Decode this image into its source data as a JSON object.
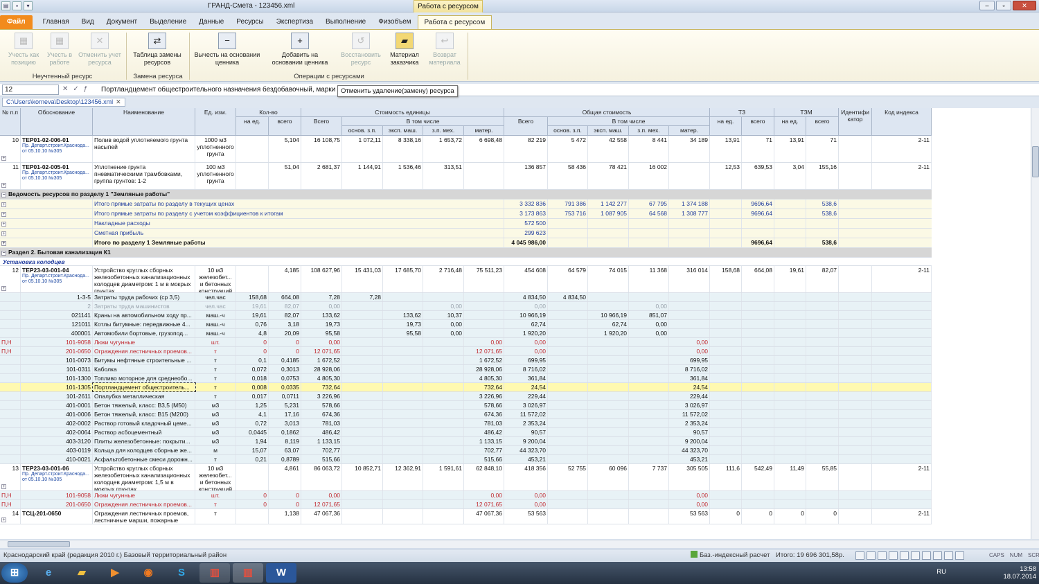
{
  "title": {
    "doc": "ГРАНД-Смета - 123456.xml",
    "context_tab": "Работа с ресурсом"
  },
  "menu": {
    "file": "Файл",
    "tabs": [
      "Главная",
      "Вид",
      "Документ",
      "Выделение",
      "Данные",
      "Ресурсы",
      "Экспертиза",
      "Выполнение",
      "Физобъем"
    ],
    "active": "Работа с ресурсом"
  },
  "ribbon": {
    "b1": "Учесть как позицию",
    "b2": "Учесть в работе",
    "b3": "Отменить учет ресурса",
    "g1": "Неучтенный ресурс",
    "b4": "Таблица замены ресурсов",
    "g2": "Замена ресурса",
    "b5": "Вычесть на основании ценника",
    "b6": "Добавить на основании ценника",
    "b7": "Восстановить ресурс",
    "b8": "Материал заказчика",
    "b9": "Возврат материала",
    "g3": "Операции с ресурсами"
  },
  "formula": {
    "cell": "12",
    "value": "Портландцемент общестроительного назначения бездобавочный, марки",
    "tooltip": "Отменить удаление(замену) ресурса"
  },
  "doc_path": "C:\\Users\\korneva\\Desktop\\123456.xml",
  "headers": {
    "n": "№ п.п",
    "osn": "Обоснование",
    "name": "Наименование",
    "ed": "Ед. изм.",
    "kolvo": "Кол-во",
    "na_ed": "на ед.",
    "vsego": "всего",
    "stoim": "Стоимость единицы",
    "v_tom": "В том числе",
    "vsego2": "Всего",
    "osn_zp": "основ. з.п.",
    "eksp": "эксп. маш.",
    "zpmeh": "з.п. мех.",
    "mater": "матер.",
    "obsh": "Общая стоимость",
    "tz": "ТЗ",
    "tzm": "ТЗМ",
    "ident": "Идентифи катор",
    "kod": "Код индекса"
  },
  "sub": {
    "a": "Пр. Департ.строит.Краснода...",
    "b": "от 05.10.10 №305"
  },
  "rows": [
    {
      "t": "pos",
      "n": "10",
      "osn": "ТЕР01-02-006-01",
      "name": "Полив водой уплотняемого грунта насыпей",
      "ed": "1000 м3 уплотненного грунта",
      "v": [
        "",
        "5,104",
        "16 108,75",
        "1 072,11",
        "8 338,16",
        "1 653,72",
        "6 698,48",
        "82 219",
        "5 472",
        "42 558",
        "8 441",
        "34 189",
        "13,91",
        "71",
        "13,91",
        "71",
        "",
        "2-11"
      ]
    },
    {
      "t": "pos",
      "n": "11",
      "osn": "ТЕР01-02-005-01",
      "name": "Уплотнение грунта пневматическими трамбовками, группа грунтов: 1-2",
      "ed": "100 м3 уплотненного грунта",
      "v": [
        "",
        "51,04",
        "2 681,37",
        "1 144,91",
        "1 536,46",
        "313,51",
        "",
        "136 857",
        "58 436",
        "78 421",
        "16 002",
        "",
        "12,53",
        "639,53",
        "3,04",
        "155,16",
        "",
        "2-11"
      ]
    },
    {
      "t": "sec",
      "name": "Ведомость ресурсов по разделу 1 \"Земляные работы\""
    },
    {
      "t": "tot",
      "name": "Итого прямые затраты по разделу в текущих ценах",
      "v": [
        "3 332 836",
        "791 386",
        "1 142 277",
        "67 795",
        "1 374 188",
        "",
        "9696,64",
        "",
        "538,6"
      ]
    },
    {
      "t": "tot",
      "name": "Итого прямые затраты по разделу с учетом коэффициентов к итогам",
      "v": [
        "3 173 863",
        "753 716",
        "1 087 905",
        "64 568",
        "1 308 777",
        "",
        "9696,64",
        "",
        "538,6"
      ]
    },
    {
      "t": "tot",
      "name": "Накладные расходы",
      "v": [
        "572 500",
        "",
        "",
        "",
        "",
        "",
        "",
        "",
        ""
      ]
    },
    {
      "t": "tot",
      "name": "Сметная прибыль",
      "v": [
        "299 623",
        "",
        "",
        "",
        "",
        "",
        "",
        "",
        ""
      ]
    },
    {
      "t": "totb",
      "name": "Итого по разделу 1 Земляные работы",
      "v": [
        "4 045 986,00",
        "",
        "",
        "",
        "",
        "",
        "9696,64",
        "",
        "538,6"
      ]
    },
    {
      "t": "sec",
      "name": "Раздел 2. Бытовая канализация К1"
    },
    {
      "t": "subt",
      "name": "Установка колодцев"
    },
    {
      "t": "pos",
      "n": "12",
      "osn": "ТЕР23-03-001-04",
      "name": "Устройство круглых сборных железобетонных канализационных колодцев диаметром: 1 м в мокрых грунтах",
      "ed": "10 м3 железобет... и бетонных конструкций",
      "v": [
        "",
        "4,185",
        "108 627,96",
        "15 431,03",
        "17 685,70",
        "2 716,48",
        "75 511,23",
        "454 608",
        "64 579",
        "74 015",
        "11 368",
        "316 014",
        "158,68",
        "664,08",
        "19,61",
        "82,07",
        "",
        "2-11"
      ]
    },
    {
      "t": "res",
      "code": "1-3-5",
      "name": "Затраты труда рабочих (ср 3,5)",
      "ed": "чел.час",
      "v": [
        "158,68",
        "664,08",
        "7,28",
        "7,28",
        "",
        "",
        "",
        "4 834,50",
        "4 834,50",
        "",
        "",
        "",
        "",
        "",
        "",
        "",
        "",
        ""
      ]
    },
    {
      "t": "resg",
      "code": "2",
      "name": "Затраты труда машинистов",
      "ed": "чел.час",
      "v": [
        "19,61",
        "82,07",
        "0,00",
        "",
        "",
        "0,00",
        "",
        "0,00",
        "",
        "",
        "0,00",
        "",
        "",
        "",
        "",
        "",
        "",
        ""
      ]
    },
    {
      "t": "res",
      "code": "021141",
      "name": "Краны на автомобильном ходу пр...",
      "ed": "маш.-ч",
      "v": [
        "19,61",
        "82,07",
        "133,62",
        "",
        "133,62",
        "10,37",
        "",
        "10 966,19",
        "",
        "10 966,19",
        "851,07",
        "",
        "",
        "",
        "",
        "",
        "",
        ""
      ]
    },
    {
      "t": "res",
      "code": "121011",
      "name": "Котлы битумные: передвижные 4...",
      "ed": "маш.-ч",
      "v": [
        "0,76",
        "3,18",
        "19,73",
        "",
        "19,73",
        "0,00",
        "",
        "62,74",
        "",
        "62,74",
        "0,00",
        "",
        "",
        "",
        "",
        "",
        "",
        ""
      ]
    },
    {
      "t": "res",
      "code": "400001",
      "name": "Автомобили бортовые, грузопод...",
      "ed": "маш.-ч",
      "v": [
        "4,8",
        "20,09",
        "95,58",
        "",
        "95,58",
        "0,00",
        "",
        "1 920,20",
        "",
        "1 920,20",
        "0,00",
        "",
        "",
        "",
        "",
        "",
        "",
        ""
      ]
    },
    {
      "t": "resr",
      "pfx": "П,Н",
      "code": "101-9058",
      "name": "Люки чугунные",
      "ed": "шт.",
      "v": [
        "0",
        "0",
        "0,00",
        "",
        "",
        "",
        "0,00",
        "0,00",
        "",
        "",
        "",
        "0,00",
        "",
        "",
        "",
        "",
        "",
        ""
      ]
    },
    {
      "t": "resr",
      "pfx": "П,Н",
      "code": "201-0650",
      "name": "Ограждения лестничных проемов...",
      "ed": "т",
      "v": [
        "0",
        "0",
        "12 071,65",
        "",
        "",
        "",
        "12 071,65",
        "0,00",
        "",
        "",
        "",
        "0,00",
        "",
        "",
        "",
        "",
        "",
        ""
      ]
    },
    {
      "t": "res",
      "code": "101-0073",
      "name": "Битумы нефтяные строительные ...",
      "ed": "т",
      "v": [
        "0,1",
        "0,4185",
        "1 672,52",
        "",
        "",
        "",
        "1 672,52",
        "699,95",
        "",
        "",
        "",
        "699,95",
        "",
        "",
        "",
        "",
        "",
        ""
      ]
    },
    {
      "t": "res",
      "code": "101-0311",
      "name": "Каболка",
      "ed": "т",
      "v": [
        "0,072",
        "0,3013",
        "28 928,06",
        "",
        "",
        "",
        "28 928,06",
        "8 716,02",
        "",
        "",
        "",
        "8 716,02",
        "",
        "",
        "",
        "",
        "",
        ""
      ]
    },
    {
      "t": "res",
      "code": "101-1300",
      "name": "Топливо моторное для среднеобо...",
      "ed": "т",
      "v": [
        "0,018",
        "0,0753",
        "4 805,30",
        "",
        "",
        "",
        "4 805,30",
        "361,84",
        "",
        "",
        "",
        "361,84",
        "",
        "",
        "",
        "",
        "",
        ""
      ]
    },
    {
      "t": "sel",
      "code": "101-1305",
      "name": "Портландцемент общестроитель...",
      "ed": "т",
      "v": [
        "0,008",
        "0,0335",
        "732,64",
        "",
        "",
        "",
        "732,64",
        "24,54",
        "",
        "",
        "",
        "24,54",
        "",
        "",
        "",
        "",
        "",
        ""
      ]
    },
    {
      "t": "res",
      "code": "101-2611",
      "name": "Опалубка металлическая",
      "ed": "т",
      "v": [
        "0,017",
        "0,0711",
        "3 226,96",
        "",
        "",
        "",
        "3 226,96",
        "229,44",
        "",
        "",
        "",
        "229,44",
        "",
        "",
        "",
        "",
        "",
        ""
      ]
    },
    {
      "t": "res",
      "code": "401-0001",
      "name": "Бетон тяжелый, класс: В3,5 (М50)",
      "ed": "м3",
      "v": [
        "1,25",
        "5,231",
        "578,66",
        "",
        "",
        "",
        "578,66",
        "3 026,97",
        "",
        "",
        "",
        "3 026,97",
        "",
        "",
        "",
        "",
        "",
        ""
      ]
    },
    {
      "t": "res",
      "code": "401-0006",
      "name": "Бетон тяжелый, класс: В15 (М200)",
      "ed": "м3",
      "v": [
        "4,1",
        "17,16",
        "674,36",
        "",
        "",
        "",
        "674,36",
        "11 572,02",
        "",
        "",
        "",
        "11 572,02",
        "",
        "",
        "",
        "",
        "",
        ""
      ]
    },
    {
      "t": "res",
      "code": "402-0002",
      "name": "Раствор готовый кладочный цеме...",
      "ed": "м3",
      "v": [
        "0,72",
        "3,013",
        "781,03",
        "",
        "",
        "",
        "781,03",
        "2 353,24",
        "",
        "",
        "",
        "2 353,24",
        "",
        "",
        "",
        "",
        "",
        ""
      ]
    },
    {
      "t": "res",
      "code": "402-0064",
      "name": "Раствор асбоцементный",
      "ed": "м3",
      "v": [
        "0,0445",
        "0,1862",
        "486,42",
        "",
        "",
        "",
        "486,42",
        "90,57",
        "",
        "",
        "",
        "90,57",
        "",
        "",
        "",
        "",
        "",
        ""
      ]
    },
    {
      "t": "res",
      "code": "403-3120",
      "name": "Плиты железобетонные: покрыти...",
      "ed": "м3",
      "v": [
        "1,94",
        "8,119",
        "1 133,15",
        "",
        "",
        "",
        "1 133,15",
        "9 200,04",
        "",
        "",
        "",
        "9 200,04",
        "",
        "",
        "",
        "",
        "",
        ""
      ]
    },
    {
      "t": "res",
      "code": "403-0119",
      "name": "Кольца для колодцев сборные же...",
      "ed": "м",
      "v": [
        "15,07",
        "63,07",
        "702,77",
        "",
        "",
        "",
        "702,77",
        "44 323,70",
        "",
        "",
        "",
        "44 323,70",
        "",
        "",
        "",
        "",
        "",
        ""
      ]
    },
    {
      "t": "res",
      "code": "410-0021",
      "name": "Асфальтобетонные смеси дорожн...",
      "ed": "т",
      "v": [
        "0,21",
        "0,8789",
        "515,66",
        "",
        "",
        "",
        "515,66",
        "453,21",
        "",
        "",
        "",
        "453,21",
        "",
        "",
        "",
        "",
        "",
        ""
      ]
    },
    {
      "t": "pos",
      "n": "13",
      "osn": "ТЕР23-03-001-06",
      "name": "Устройство круглых сборных железобетонных канализационных колодцев диаметром: 1,5 м в мокрых грунтах",
      "ed": "10 м3 железобет... и бетонных конструкций",
      "v": [
        "",
        "4,861",
        "86 063,72",
        "10 852,71",
        "12 362,91",
        "1 591,61",
        "62 848,10",
        "418 356",
        "52 755",
        "60 096",
        "7 737",
        "305 505",
        "111,6",
        "542,49",
        "11,49",
        "55,85",
        "",
        "2-11"
      ]
    },
    {
      "t": "resr",
      "pfx": "П,Н",
      "code": "101-9058",
      "name": "Люки чугунные",
      "ed": "шт.",
      "v": [
        "0",
        "0",
        "0,00",
        "",
        "",
        "",
        "0,00",
        "0,00",
        "",
        "",
        "",
        "0,00",
        "",
        "",
        "",
        "",
        "",
        ""
      ]
    },
    {
      "t": "resr",
      "pfx": "П,Н",
      "code": "201-0650",
      "name": "Ограждения лестничных проемов...",
      "ed": "т",
      "v": [
        "0",
        "0",
        "12 071,65",
        "",
        "",
        "",
        "12 071,65",
        "0,00",
        "",
        "",
        "",
        "0,00",
        "",
        "",
        "",
        "",
        "",
        ""
      ]
    },
    {
      "t": "pos2",
      "n": "14",
      "osn": "ТСЦ-201-0650",
      "name": "Ограждения лестничных проемов, лестничные марши, пожарные",
      "ed": "т",
      "v": [
        "",
        "1,138",
        "47 067,36",
        "",
        "",
        "",
        "47 067,36",
        "53 563",
        "",
        "",
        "",
        "53 563",
        "0",
        "0",
        "0",
        "0",
        "",
        "2-11"
      ]
    }
  ],
  "status": {
    "region": "Краснодарский край (редакция 2010 г.)  Базовый территориальный район",
    "calc": "Баз.-индексный расчет",
    "total": "Итого: 19 696 301,58р.",
    "caps": "CAPS",
    "num": "NUM",
    "scrl": "SCRL"
  },
  "tray": {
    "lang": "RU",
    "time": "13:58",
    "date": "18.07.2014"
  },
  "colors": {
    "file_tab": "#f28b1d",
    "context_tab": "#f2e29a",
    "section": "#d6d6d6",
    "totals": "#fbf9e5",
    "resource": "#e8f2f6",
    "selected": "#fff9b0",
    "red": "#c0262d",
    "blue": "#1f3b9e"
  }
}
